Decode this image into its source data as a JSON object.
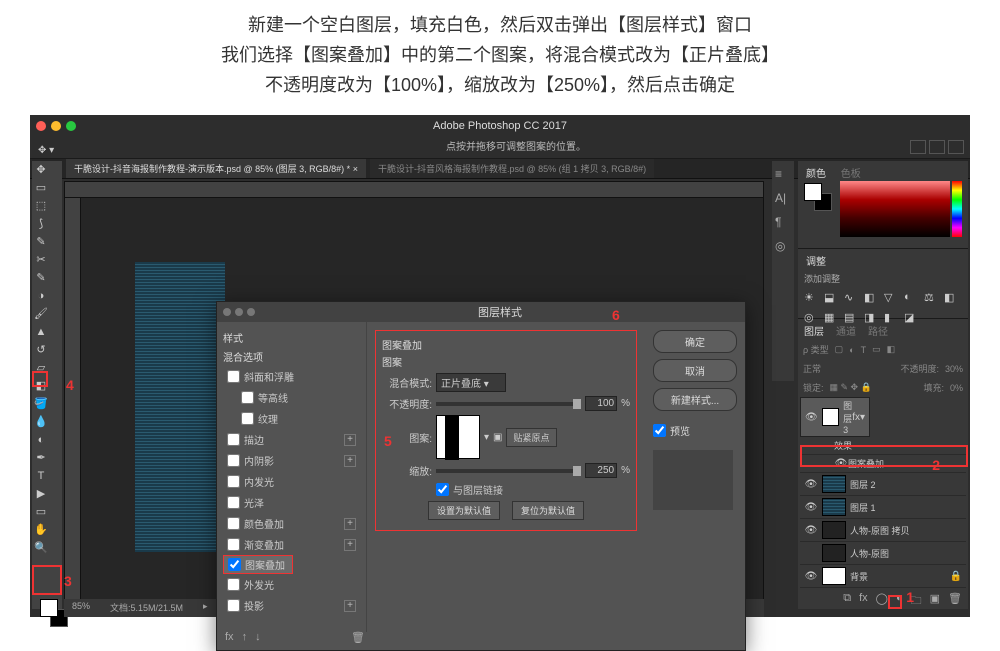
{
  "instructions": {
    "line1": "新建一个空白图层，填充白色，然后双击弹出【图层样式】窗口",
    "line2": "我们选择【图案叠加】中的第二个图案，将混合模式改为【正片叠底】",
    "line3": "不透明度改为【100%】，缩放改为【250%】，然后点击确定"
  },
  "app": {
    "title": "Adobe Photoshop CC 2017",
    "option_hint": "点按并拖移可调整图案的位置。"
  },
  "tabs": [
    "干脆设计-抖音海报制作教程-演示版本.psd @ 85% (图层 3, RGB/8#) *",
    "干脆设计-抖音风格海报制作教程.psd @ 85% (组 1 拷贝 3, RGB/8#)"
  ],
  "status": {
    "zoom": "85%",
    "doc": "文档:5.15M/21.5M"
  },
  "panels": {
    "color_tab": "颜色",
    "swatch_tab": "色板",
    "adjust_tab": "调整",
    "adjust_hint": "添加调整",
    "layers_tab": "图层",
    "channels_tab": "通道",
    "paths_tab": "路径",
    "kind": "ρ 类型",
    "blend": "正常",
    "opacity_label": "不透明度:",
    "opacity_val": "30%",
    "lock": "锁定:",
    "fill_label": "填充:",
    "fill_val": "0%"
  },
  "layers": [
    {
      "name": "图层 3",
      "fx": "fx",
      "thumb": "white"
    },
    {
      "name": "效果",
      "sub": true
    },
    {
      "name": "图案叠加",
      "sub": true,
      "eye": true
    },
    {
      "name": "图层 2",
      "thumb": "pat"
    },
    {
      "name": "图层 1",
      "thumb": "pat"
    },
    {
      "name": "人物-原图 拷贝",
      "thumb": "dark"
    },
    {
      "name": "人物-原图",
      "thumb": "dark"
    },
    {
      "name": "背景",
      "thumb": "white"
    }
  ],
  "dialog": {
    "title": "图层样式",
    "left_head": "样式",
    "blend_opts": "混合选项",
    "styles": [
      {
        "label": "斜面和浮雕"
      },
      {
        "label": "等高线"
      },
      {
        "label": "纹理"
      },
      {
        "label": "描边",
        "plus": true
      },
      {
        "label": "内阴影",
        "plus": true
      },
      {
        "label": "内发光"
      },
      {
        "label": "光泽"
      },
      {
        "label": "颜色叠加",
        "plus": true
      },
      {
        "label": "渐变叠加",
        "plus": true
      },
      {
        "label": "图案叠加",
        "checked": true,
        "selected": true
      },
      {
        "label": "外发光"
      },
      {
        "label": "投影",
        "plus": true
      }
    ],
    "overlay": {
      "title": "图案叠加",
      "sub": "图案",
      "mode_label": "混合模式:",
      "mode_val": "正片叠底",
      "opacity_label": "不透明度:",
      "opacity_val": "100",
      "pct": "%",
      "pattern_label": "图案:",
      "snap": "贴紧原点",
      "scale_label": "缩放:",
      "scale_val": "250",
      "link": "与图层链接",
      "set_default": "设置为默认值",
      "reset_default": "复位为默认值"
    },
    "buttons": {
      "ok": "确定",
      "cancel": "取消",
      "newstyle": "新建样式...",
      "preview": "预览"
    }
  },
  "annotations": {
    "a1": "1",
    "a2": "2",
    "a3": "3",
    "a4": "4",
    "a5": "5",
    "a6": "6"
  }
}
